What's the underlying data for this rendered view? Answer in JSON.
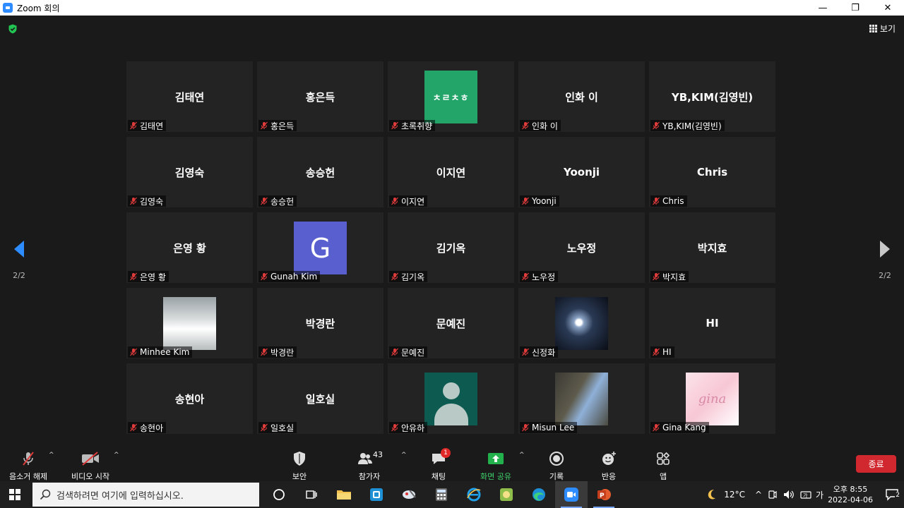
{
  "window": {
    "title": "Zoom 회의",
    "minimize": "—",
    "restore": "❐",
    "close": "✕"
  },
  "header": {
    "view_label": "보기"
  },
  "pager": {
    "left": "2/2",
    "right": "2/2"
  },
  "participants": [
    {
      "display": "김태연",
      "label": "김태연",
      "avatar": "none"
    },
    {
      "display": "홍은득",
      "label": "홍은득",
      "avatar": "none"
    },
    {
      "display": "",
      "label": "초록취향",
      "avatar": "green",
      "avatar_text": "ㅊㄹㅊㅎ"
    },
    {
      "display": "인화 이",
      "label": "인화 이",
      "avatar": "none"
    },
    {
      "display": "YB,KIM(김영빈)",
      "label": "YB,KIM(김영빈)",
      "avatar": "none"
    },
    {
      "display": "김영숙",
      "label": "김영숙",
      "avatar": "none"
    },
    {
      "display": "송승헌",
      "label": "송승헌",
      "avatar": "none"
    },
    {
      "display": "이지연",
      "label": "이지연",
      "avatar": "none"
    },
    {
      "display": "Yoonji",
      "label": "Yoonji",
      "avatar": "none"
    },
    {
      "display": "Chris",
      "label": "Chris",
      "avatar": "none"
    },
    {
      "display": "은영 황",
      "label": "은영 황",
      "avatar": "none"
    },
    {
      "display": "",
      "label": "Gunah Kim",
      "avatar": "g",
      "avatar_text": "G"
    },
    {
      "display": "김기옥",
      "label": "김기옥",
      "avatar": "none"
    },
    {
      "display": "노우정",
      "label": "노우정",
      "avatar": "none"
    },
    {
      "display": "박지효",
      "label": "박지효",
      "avatar": "none"
    },
    {
      "display": "",
      "label": "Minhee Kim",
      "avatar": "snow"
    },
    {
      "display": "박경란",
      "label": "박경란",
      "avatar": "none"
    },
    {
      "display": "문예진",
      "label": "문예진",
      "avatar": "none"
    },
    {
      "display": "",
      "label": "신정화",
      "avatar": "space"
    },
    {
      "display": "HI",
      "label": "HI",
      "avatar": "none"
    },
    {
      "display": "송현아",
      "label": "송현아",
      "avatar": "none"
    },
    {
      "display": "일호실",
      "label": "일호실",
      "avatar": "none"
    },
    {
      "display": "",
      "label": "안유하",
      "avatar": "person"
    },
    {
      "display": "",
      "label": "Misun Lee",
      "avatar": "rock"
    },
    {
      "display": "",
      "label": "Gina Kang",
      "avatar": "gina",
      "avatar_text": "gina"
    }
  ],
  "toolbar": {
    "unmute": "음소거 해제",
    "start_video": "비디오 시작",
    "security": "보안",
    "participants": "참가자",
    "participant_count": "43",
    "chat": "채팅",
    "chat_badge": "1",
    "share_screen": "화면 공유",
    "record": "기록",
    "reactions": "반응",
    "apps": "앱",
    "end": "종료"
  },
  "taskbar": {
    "search_placeholder": "검색하려면 여기에 입력하십시오.",
    "temperature": "12°C",
    "ime": "가",
    "time": "오후 8:55",
    "date": "2022-04-06",
    "notification_count": "2"
  },
  "colors": {
    "accent": "#2d8cff",
    "end_button": "#d0282e",
    "share_green": "#22b14c",
    "muted_red": "#e03b3b"
  }
}
